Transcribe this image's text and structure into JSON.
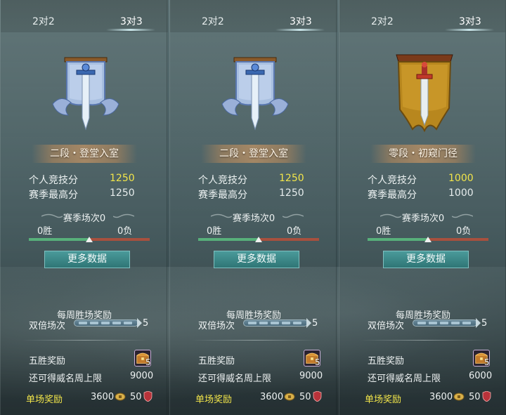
{
  "panels": [
    {
      "tabs": {
        "left": "2对2",
        "right": "3对3"
      },
      "emblem": "blue-sword-banner",
      "rank": "二段・登堂入室",
      "personal_score_label": "个人竞技分",
      "personal_score": "1250",
      "season_high_label": "赛季最高分",
      "season_high": "1250",
      "season_matches": "赛季场次0",
      "wins": "0胜",
      "losses": "0负",
      "win_ratio": 0.5,
      "more_button": "更多数据",
      "weekly_title": "每周胜场奖励",
      "double_label": "双倍场次",
      "double_count": "5",
      "five_win_label": "五胜奖励",
      "five_win_count": "5",
      "limit_label": "还可得威名周上限",
      "limit_value": "9000",
      "single_label": "单场奖励",
      "single_coins": "3600",
      "single_honor": "50"
    },
    {
      "tabs": {
        "left": "2对2",
        "right": "3对3"
      },
      "emblem": "blue-sword-banner",
      "rank": "二段・登堂入室",
      "personal_score_label": "个人竞技分",
      "personal_score": "1250",
      "season_high_label": "赛季最高分",
      "season_high": "1250",
      "season_matches": "赛季场次0",
      "wins": "0胜",
      "losses": "0负",
      "win_ratio": 0.5,
      "more_button": "更多数据",
      "weekly_title": "每周胜场奖励",
      "double_label": "双倍场次",
      "double_count": "5",
      "five_win_label": "五胜奖励",
      "five_win_count": "5",
      "limit_label": "还可得威名周上限",
      "limit_value": "9000",
      "single_label": "单场奖励",
      "single_coins": "3600",
      "single_honor": "50"
    },
    {
      "tabs": {
        "left": "2对2",
        "right": "3对3"
      },
      "emblem": "gold-sword-banner",
      "rank": "零段・初窥门径",
      "personal_score_label": "个人竞技分",
      "personal_score": "1000",
      "season_high_label": "赛季最高分",
      "season_high": "1000",
      "season_matches": "赛季场次0",
      "wins": "0胜",
      "losses": "0负",
      "win_ratio": 0.5,
      "more_button": "更多数据",
      "weekly_title": "每周胜场奖励",
      "double_label": "双倍场次",
      "double_count": "5",
      "five_win_label": "五胜奖励",
      "five_win_count": "5",
      "limit_label": "还可得威名周上限",
      "limit_value": "6000",
      "single_label": "单场奖励",
      "single_coins": "3600",
      "single_honor": "50"
    }
  ],
  "colors": {
    "highlight_yellow": "#f2e54a",
    "win_green": "#57b07a",
    "loss_red": "#a8503e",
    "button_teal": "#2f7676"
  }
}
